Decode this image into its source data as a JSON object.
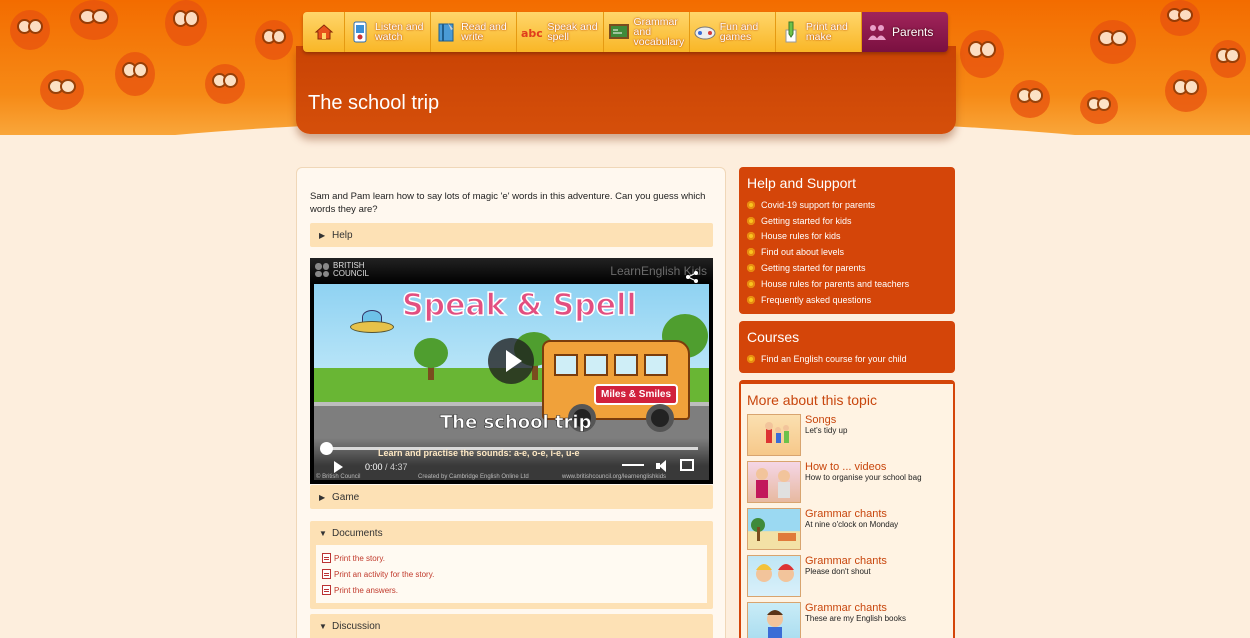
{
  "nav": {
    "items": [
      {
        "id": "home",
        "label": "",
        "icon": "home-icon"
      },
      {
        "id": "listen",
        "label": "Listen and watch",
        "icon": "media-player-icon"
      },
      {
        "id": "read",
        "label": "Read and write",
        "icon": "book-icon"
      },
      {
        "id": "speak",
        "label": "Speak and spell",
        "icon": "abc-icon"
      },
      {
        "id": "grammar",
        "label": "Grammar and vocabulary",
        "icon": "blackboard-icon"
      },
      {
        "id": "fun",
        "label": "Fun and games",
        "icon": "game-controller-icon"
      },
      {
        "id": "print",
        "label": "Print and make",
        "icon": "pencil-icon"
      },
      {
        "id": "parents",
        "label": "Parents",
        "icon": "parents-icon"
      }
    ]
  },
  "page": {
    "title": "The school trip",
    "intro": "Sam and Pam learn how to say lots of magic 'e' words in this adventure. Can you guess which words they are?"
  },
  "accordions": {
    "help": "Help",
    "game": "Game",
    "documents": "Documents",
    "discussion": "Discussion"
  },
  "documents": [
    "Print the story.",
    "Print an activity for the story.",
    "Print the answers."
  ],
  "video": {
    "brand": "BRITISH COUNCIL",
    "channel": "LearnEnglish Kids",
    "title": "Speak & Spell",
    "bus_sign": "Miles & Smiles",
    "episode": "The school trip",
    "subtitle": "Learn and practise the sounds: a-e, o-e, i-e, u-e",
    "current_time": "0:00",
    "duration": "/ 4:37",
    "progress": 0.0,
    "footer_left": "© British Council",
    "footer_mid": "Created by Cambridge English Online Ltd",
    "footer_right": "www.britishcouncil.org/learnenglishkids"
  },
  "sidebar": {
    "help": {
      "title": "Help and Support",
      "items": [
        "Covid-19 support for parents",
        "Getting started for kids",
        "House rules for kids",
        "Find out about levels",
        "Getting started for parents",
        "House rules for parents and teachers",
        "Frequently asked questions"
      ]
    },
    "courses": {
      "title": "Courses",
      "items": [
        "Find an English course for your child"
      ]
    },
    "topic": {
      "title": "More about this topic",
      "items": [
        {
          "title": "Songs",
          "sub": "Let's tidy up"
        },
        {
          "title": "How to ... videos",
          "sub": "How to organise your school bag"
        },
        {
          "title": "Grammar chants",
          "sub": "At nine o'clock on Monday"
        },
        {
          "title": "Grammar chants",
          "sub": "Please don't shout"
        },
        {
          "title": "Grammar chants",
          "sub": "These are my English books"
        }
      ]
    }
  },
  "colors": {
    "accent": "#d44509",
    "nav": "#f9b626",
    "parents": "#7a1040",
    "page_bg": "#fdeedd"
  }
}
